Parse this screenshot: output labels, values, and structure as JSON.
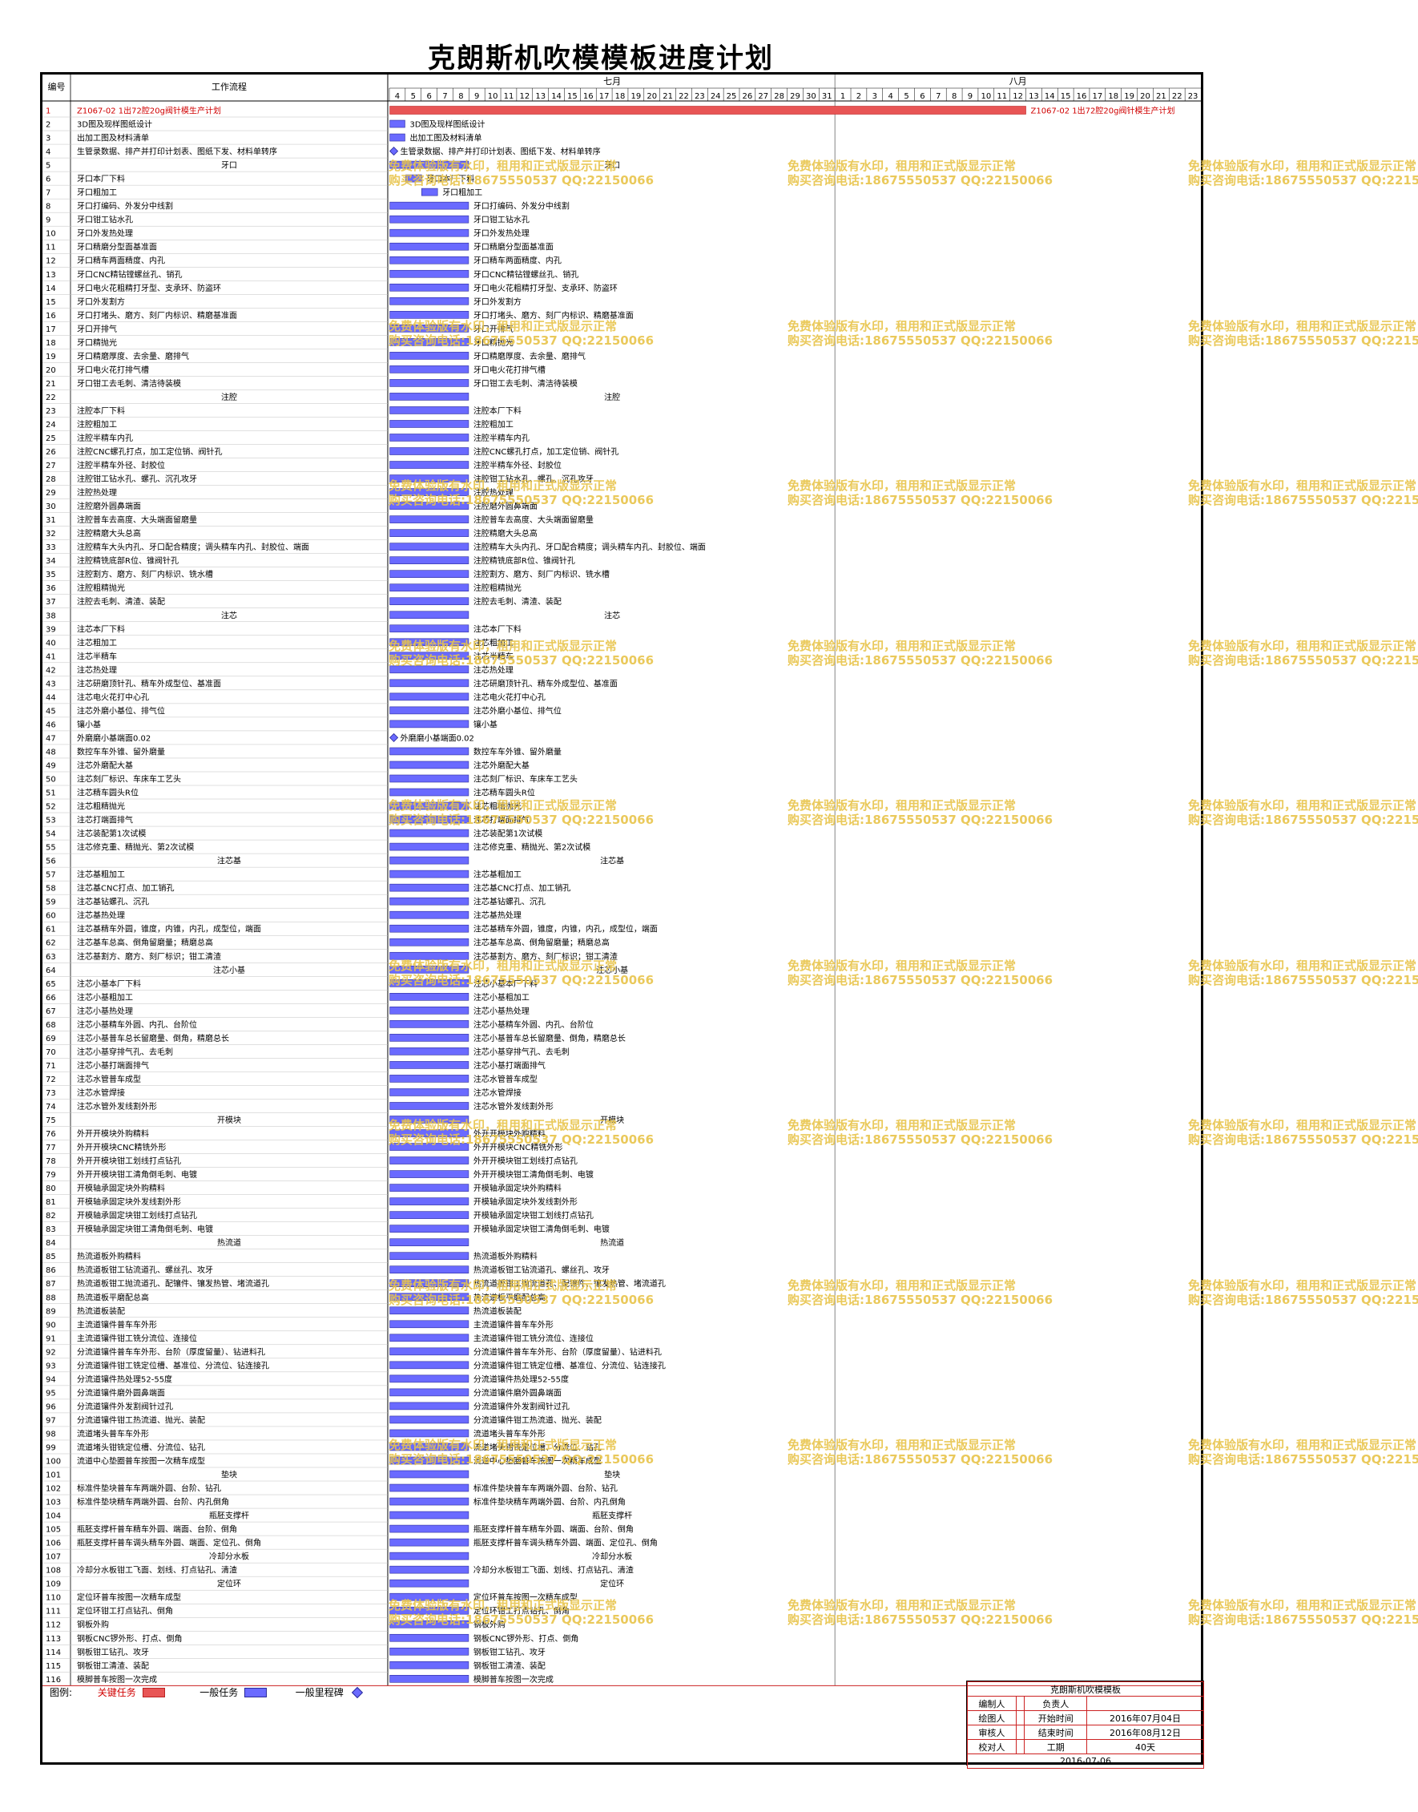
{
  "title": "克朗斯机吹模模板进度计划",
  "header": {
    "col_id": "编号",
    "col_task": "工作流程",
    "month1": "七月",
    "month2": "八月"
  },
  "days_july": [
    "4",
    "5",
    "6",
    "7",
    "8",
    "9",
    "10",
    "11",
    "12",
    "13",
    "14",
    "15",
    "16",
    "17",
    "18",
    "19",
    "20",
    "21",
    "22",
    "23",
    "24",
    "25",
    "26",
    "27",
    "28",
    "29",
    "30",
    "31"
  ],
  "days_august": [
    "1",
    "2",
    "3",
    "4",
    "5",
    "6",
    "7",
    "8",
    "9",
    "10",
    "11",
    "12",
    "13",
    "14",
    "15",
    "16",
    "17",
    "18",
    "19",
    "20",
    "21",
    "22",
    "23"
  ],
  "colors": {
    "critical": "#e85555",
    "critical_text": "#d00000",
    "normal": "#6a6aff",
    "normal_border": "#2b2b9a",
    "watermark": "#e8c44a",
    "grid": "#c0c0c0"
  },
  "tasks": [
    {
      "id": "1",
      "name": "Z1067-02 1出72腔20g阀针模生产计划",
      "type": "critical"
    },
    {
      "id": "2",
      "name": "3D图及现样图纸设计",
      "type": "short"
    },
    {
      "id": "3",
      "name": "出加工图及材料清单",
      "type": "short"
    },
    {
      "id": "4",
      "name": "生管录数据、排产并打印计划表、图纸下发、材料单转序",
      "type": "milestone"
    },
    {
      "id": "5",
      "name": "牙口",
      "type": "group"
    },
    {
      "id": "6",
      "name": "牙口本厂下料",
      "type": "early"
    },
    {
      "id": "7",
      "name": "牙口粗加工",
      "type": "early2"
    },
    {
      "id": "8",
      "name": "牙口打编码、外发分中线割",
      "type": "task"
    },
    {
      "id": "9",
      "name": "牙口钳工钻水孔",
      "type": "task"
    },
    {
      "id": "10",
      "name": "牙口外发热处理",
      "type": "task"
    },
    {
      "id": "11",
      "name": "牙口精磨分型面基准面",
      "type": "task"
    },
    {
      "id": "12",
      "name": "牙口精车两面精度、内孔",
      "type": "task"
    },
    {
      "id": "13",
      "name": "牙口CNC精钻镗螺丝孔、销孔",
      "type": "task"
    },
    {
      "id": "14",
      "name": "牙口电火花粗精打牙型、支承环、防盗环",
      "type": "task"
    },
    {
      "id": "15",
      "name": "牙口外发割方",
      "type": "task"
    },
    {
      "id": "16",
      "name": "牙口打堵头、磨方、刻厂内标识、精磨基准面",
      "type": "task"
    },
    {
      "id": "17",
      "name": "牙口开排气",
      "type": "task"
    },
    {
      "id": "18",
      "name": "牙口精抛光",
      "type": "task"
    },
    {
      "id": "19",
      "name": "牙口精磨厚度、去余量、磨排气",
      "type": "task"
    },
    {
      "id": "20",
      "name": "牙口电火花打排气槽",
      "type": "task"
    },
    {
      "id": "21",
      "name": "牙口钳工去毛刺、清洁待装模",
      "type": "task"
    },
    {
      "id": "22",
      "name": "注腔",
      "type": "group"
    },
    {
      "id": "23",
      "name": "注腔本厂下料",
      "type": "task"
    },
    {
      "id": "24",
      "name": "注腔粗加工",
      "type": "task"
    },
    {
      "id": "25",
      "name": "注腔半精车内孔",
      "type": "task"
    },
    {
      "id": "26",
      "name": "注腔CNC螺孔打点，加工定位销、阀针孔",
      "type": "task"
    },
    {
      "id": "27",
      "name": "注腔半精车外径、封胶位",
      "type": "task"
    },
    {
      "id": "28",
      "name": "注腔钳工钻水孔、螺孔、沉孔攻牙",
      "type": "task"
    },
    {
      "id": "29",
      "name": "注腔热处理",
      "type": "task"
    },
    {
      "id": "30",
      "name": "注腔磨外圆鼻端面",
      "type": "task"
    },
    {
      "id": "31",
      "name": "注腔普车去高度、大头端面留磨量",
      "type": "task"
    },
    {
      "id": "32",
      "name": "注腔精磨大头总高",
      "type": "task"
    },
    {
      "id": "33",
      "name": "注腔精车大头内孔、牙口配合精度；调头精车内孔、封胶位、端面",
      "type": "task"
    },
    {
      "id": "34",
      "name": "注腔精铣底部R位、锥阀针孔",
      "type": "task"
    },
    {
      "id": "35",
      "name": "注腔割方、磨方、刻厂内标识、铣水槽",
      "type": "task"
    },
    {
      "id": "36",
      "name": "注腔粗精抛光",
      "type": "task"
    },
    {
      "id": "37",
      "name": "注腔去毛刺、清渣、装配",
      "type": "task"
    },
    {
      "id": "38",
      "name": "注芯",
      "type": "group"
    },
    {
      "id": "39",
      "name": "注芯本厂下料",
      "type": "task"
    },
    {
      "id": "40",
      "name": "注芯粗加工",
      "type": "task"
    },
    {
      "id": "41",
      "name": "注芯半精车",
      "type": "task"
    },
    {
      "id": "42",
      "name": "注芯热处理",
      "type": "task"
    },
    {
      "id": "43",
      "name": "注芯研磨顶针孔、精车外成型位、基准面",
      "type": "task"
    },
    {
      "id": "44",
      "name": "注芯电火花打中心孔",
      "type": "task"
    },
    {
      "id": "45",
      "name": "注芯外磨小基位、排气位",
      "type": "task"
    },
    {
      "id": "46",
      "name": "镶小基",
      "type": "task"
    },
    {
      "id": "47",
      "name": "外磨磨小基端面0.02",
      "type": "milestone"
    },
    {
      "id": "48",
      "name": "数控车车外锥、留外磨量",
      "type": "task"
    },
    {
      "id": "49",
      "name": "注芯外磨配大基",
      "type": "task"
    },
    {
      "id": "50",
      "name": "注芯刻厂标识、车床车工艺头",
      "type": "task"
    },
    {
      "id": "51",
      "name": "注芯精车圆头R位",
      "type": "task"
    },
    {
      "id": "52",
      "name": "注芯粗精抛光",
      "type": "task"
    },
    {
      "id": "53",
      "name": "注芯打端面排气",
      "type": "task"
    },
    {
      "id": "54",
      "name": "注芯装配第1次试模",
      "type": "task"
    },
    {
      "id": "55",
      "name": "注芯修克重、精抛光、第2次试模",
      "type": "task"
    },
    {
      "id": "56",
      "name": "注芯基",
      "type": "group"
    },
    {
      "id": "57",
      "name": "注芯基粗加工",
      "type": "task"
    },
    {
      "id": "58",
      "name": "注芯基CNC打点、加工销孔",
      "type": "task"
    },
    {
      "id": "59",
      "name": "注芯基钻螺孔、沉孔",
      "type": "task"
    },
    {
      "id": "60",
      "name": "注芯基热处理",
      "type": "task"
    },
    {
      "id": "61",
      "name": "注芯基精车外圆，锥度，内锥，内孔，成型位，端面",
      "type": "task"
    },
    {
      "id": "62",
      "name": "注芯基车总高、倒角留磨量；精磨总高",
      "type": "task"
    },
    {
      "id": "63",
      "name": "注芯基割方、磨方、刻厂标识；钳工清渣",
      "type": "task"
    },
    {
      "id": "64",
      "name": "注芯小基",
      "type": "group"
    },
    {
      "id": "65",
      "name": "注芯小基本厂下料",
      "type": "task"
    },
    {
      "id": "66",
      "name": "注芯小基粗加工",
      "type": "task"
    },
    {
      "id": "67",
      "name": "注芯小基热处理",
      "type": "task"
    },
    {
      "id": "68",
      "name": "注芯小基精车外圆、内孔、台阶位",
      "type": "task"
    },
    {
      "id": "69",
      "name": "注芯小基普车总长留磨量、倒角，精磨总长",
      "type": "task"
    },
    {
      "id": "70",
      "name": "注芯小基穿排气孔、去毛刺",
      "type": "task"
    },
    {
      "id": "71",
      "name": "注芯小基打端面排气",
      "type": "task"
    },
    {
      "id": "72",
      "name": "注芯水管普车成型",
      "type": "task"
    },
    {
      "id": "73",
      "name": "注芯水管焊接",
      "type": "task"
    },
    {
      "id": "74",
      "name": "注芯水管外发线割外形",
      "type": "task"
    },
    {
      "id": "75",
      "name": "开模块",
      "type": "group"
    },
    {
      "id": "76",
      "name": "外开开模块外购精料",
      "type": "task"
    },
    {
      "id": "77",
      "name": "外开开模块CNC精铣外形",
      "type": "task"
    },
    {
      "id": "78",
      "name": "外开开模块钳工划线打点钻孔",
      "type": "task"
    },
    {
      "id": "79",
      "name": "外开开模块钳工清角倒毛刺、电镀",
      "type": "task"
    },
    {
      "id": "80",
      "name": "开模轴承固定块外购精料",
      "type": "task"
    },
    {
      "id": "81",
      "name": "开模轴承固定块外发线割外形",
      "type": "task"
    },
    {
      "id": "82",
      "name": "开模轴承固定块钳工划线打点钻孔",
      "type": "task"
    },
    {
      "id": "83",
      "name": "开模轴承固定块钳工清角倒毛刺、电镀",
      "type": "task"
    },
    {
      "id": "84",
      "name": "热流道",
      "type": "group"
    },
    {
      "id": "85",
      "name": "热流道板外购精料",
      "type": "task"
    },
    {
      "id": "86",
      "name": "热流道板钳工钻流道孔、螺丝孔、攻牙",
      "type": "task"
    },
    {
      "id": "87",
      "name": "热流道板钳工抛流道孔、配镶件、镶发热管、堵流道孔",
      "type": "task"
    },
    {
      "id": "88",
      "name": "热流道板平磨配总高",
      "type": "task"
    },
    {
      "id": "89",
      "name": "热流道板装配",
      "type": "task"
    },
    {
      "id": "90",
      "name": "主流道镶件普车车外形",
      "type": "task"
    },
    {
      "id": "91",
      "name": "主流道镶件钳工铣分流位、连接位",
      "type": "task"
    },
    {
      "id": "92",
      "name": "分流道镶件普车车外形、台阶（厚度留量）、钻进料孔",
      "type": "task"
    },
    {
      "id": "93",
      "name": "分流道镶件钳工铣定位槽、基准位、分流位、钻连接孔",
      "type": "task"
    },
    {
      "id": "94",
      "name": "分流道镶件热处理52-55度",
      "type": "task"
    },
    {
      "id": "95",
      "name": "分流道镶件磨外圆鼻端面",
      "type": "task"
    },
    {
      "id": "96",
      "name": "分流道镶件外发割阀针过孔",
      "type": "task"
    },
    {
      "id": "97",
      "name": "分流道镶件钳工热流道、抛光、装配",
      "type": "task"
    },
    {
      "id": "98",
      "name": "流道堵头普车车外形",
      "type": "task"
    },
    {
      "id": "99",
      "name": "流道堵头钳铣定位槽、分流位、钻孔",
      "type": "task"
    },
    {
      "id": "100",
      "name": "流道中心垫圈普车按图一次精车成型",
      "type": "task"
    },
    {
      "id": "101",
      "name": "垫块",
      "type": "group"
    },
    {
      "id": "102",
      "name": "标准件垫块普车车两端外圆、台阶、钻孔",
      "type": "task"
    },
    {
      "id": "103",
      "name": "标准件垫块精车两端外圆、台阶、内孔倒角",
      "type": "task"
    },
    {
      "id": "104",
      "name": "瓶胚支撑杆",
      "type": "group"
    },
    {
      "id": "105",
      "name": "瓶胚支撑杆普车精车外圆、端面、台阶、倒角",
      "type": "task"
    },
    {
      "id": "106",
      "name": "瓶胚支撑杆普车调头精车外圆、端面、定位孔、倒角",
      "type": "task"
    },
    {
      "id": "107",
      "name": "冷却分水板",
      "type": "group"
    },
    {
      "id": "108",
      "name": "冷却分水板钳工飞面、划线、打点钻孔、清渣",
      "type": "task"
    },
    {
      "id": "109",
      "name": "定位环",
      "type": "group"
    },
    {
      "id": "110",
      "name": "定位环普车按图一次精车成型",
      "type": "task"
    },
    {
      "id": "111",
      "name": "定位环钳工打点钻孔、倒角",
      "type": "task"
    },
    {
      "id": "112",
      "name": "钢板外购",
      "type": "task"
    },
    {
      "id": "113",
      "name": "钢板CNC锣外形、打点、倒角",
      "type": "task"
    },
    {
      "id": "114",
      "name": "钢板钳工钻孔、攻牙",
      "type": "task"
    },
    {
      "id": "115",
      "name": "钢板钳工清渣、装配",
      "type": "task"
    },
    {
      "id": "116",
      "name": "模脚普车按图一次完成",
      "type": "task"
    }
  ],
  "watermark": {
    "line1": "免费体验版有水印，租用和正式版显示正常",
    "line2": "购买咨询电话:18675550537 QQ:22150066"
  },
  "legend": {
    "label": "图例:",
    "critical": "关键任务",
    "normal": "一般任务",
    "milestone": "一般里程碑"
  },
  "title_block": {
    "project": "克朗斯机吹模模板",
    "editor_label": "编制人",
    "owner_label": "负责人",
    "drawer_label": "绘图人",
    "start_label": "开始时间",
    "start_value": "2016年07月04日",
    "reviewer_label": "审核人",
    "end_label": "结束时间",
    "end_value": "2016年08月12日",
    "checker_label": "校对人",
    "duration_label": "工期",
    "duration_value": "40天",
    "date": "2016-07-06"
  }
}
